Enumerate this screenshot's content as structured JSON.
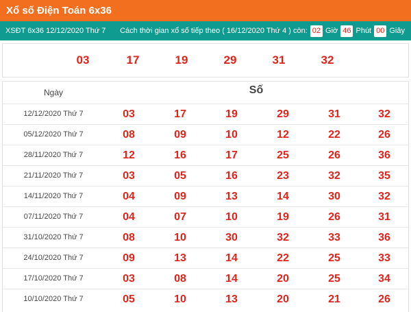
{
  "header": {
    "title": "Xổ số Điện Toán 6x36"
  },
  "info": {
    "draw_label": "XSĐT 6x36 12/12/2020 Thứ 7",
    "countdown_text": "Cách thời gian xổ số tiếp theo (  16/12/2020 Thứ 4 ) còn:",
    "hours": "02",
    "hours_label": "Giờ",
    "minutes": "46",
    "minutes_label": "Phút",
    "seconds": "00",
    "seconds_label": "Giây"
  },
  "result": {
    "numbers": [
      "03",
      "17",
      "19",
      "29",
      "31",
      "32"
    ]
  },
  "history": {
    "date_header": "Ngày",
    "numbers_header": "Số",
    "rows": [
      {
        "date": "12/12/2020 Thứ 7",
        "numbers": [
          "03",
          "17",
          "19",
          "29",
          "31",
          "32"
        ]
      },
      {
        "date": "05/12/2020 Thứ 7",
        "numbers": [
          "08",
          "09",
          "10",
          "12",
          "22",
          "26"
        ]
      },
      {
        "date": "28/11/2020 Thứ 7",
        "numbers": [
          "12",
          "16",
          "17",
          "25",
          "26",
          "36"
        ]
      },
      {
        "date": "21/11/2020 Thứ 7",
        "numbers": [
          "03",
          "05",
          "16",
          "23",
          "32",
          "35"
        ]
      },
      {
        "date": "14/11/2020 Thứ 7",
        "numbers": [
          "04",
          "09",
          "13",
          "14",
          "30",
          "32"
        ]
      },
      {
        "date": "07/11/2020 Thứ 7",
        "numbers": [
          "04",
          "07",
          "10",
          "19",
          "26",
          "31"
        ]
      },
      {
        "date": "31/10/2020 Thứ 7",
        "numbers": [
          "08",
          "10",
          "30",
          "32",
          "33",
          "36"
        ]
      },
      {
        "date": "24/10/2020 Thứ 7",
        "numbers": [
          "09",
          "13",
          "14",
          "22",
          "25",
          "33"
        ]
      },
      {
        "date": "17/10/2020 Thứ 7",
        "numbers": [
          "03",
          "08",
          "14",
          "20",
          "25",
          "34"
        ]
      },
      {
        "date": "10/10/2020 Thứ 7",
        "numbers": [
          "05",
          "10",
          "13",
          "20",
          "21",
          "26"
        ]
      }
    ]
  }
}
